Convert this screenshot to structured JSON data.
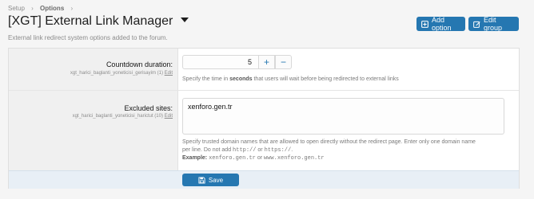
{
  "breadcrumb": {
    "items": [
      "Setup",
      "Options"
    ]
  },
  "header": {
    "title": "[XGT] External Link Manager",
    "subtitle": "External link redirect system options added to the forum.",
    "add_option_label": "Add option",
    "edit_group_label": "Edit group"
  },
  "options": {
    "countdown": {
      "label": "Countdown duration:",
      "key": "xgt_harici_baglanti_yoneticisi_gerisayim (1)",
      "edit_link": "Edit",
      "value": "5",
      "hint_before": "Specify the time in ",
      "hint_bold": "seconds",
      "hint_after": " that users will wait before being redirected to external links"
    },
    "excluded": {
      "label": "Excluded sites:",
      "key": "xgt_harici_baglanti_yoneticisi_harictut (10)",
      "edit_link": "Edit",
      "value": "xenforo.gen.tr",
      "hint_line1": "Specify trusted domain names that are allowed to open directly without the redirect page. Enter only one domain name",
      "hint_line2_a": "per line. Do not add ",
      "hint_line2_code1": "http://",
      "hint_line2_or": " or ",
      "hint_line2_code2": "https://",
      "hint_line2_end": ".",
      "example_label": "Example:",
      "example_code1": "xenforo.gen.tr",
      "example_or": " or ",
      "example_code2": "www.xenforo.gen.tr"
    }
  },
  "footer": {
    "save_label": "Save"
  },
  "colors": {
    "primary": "#2577b1"
  },
  "icons": {
    "add": "plus-square-icon",
    "edit": "edit-icon",
    "save": "save-icon",
    "dropdown": "caret-down-icon",
    "breadcrumb_sep": "chevron-right-icon"
  }
}
